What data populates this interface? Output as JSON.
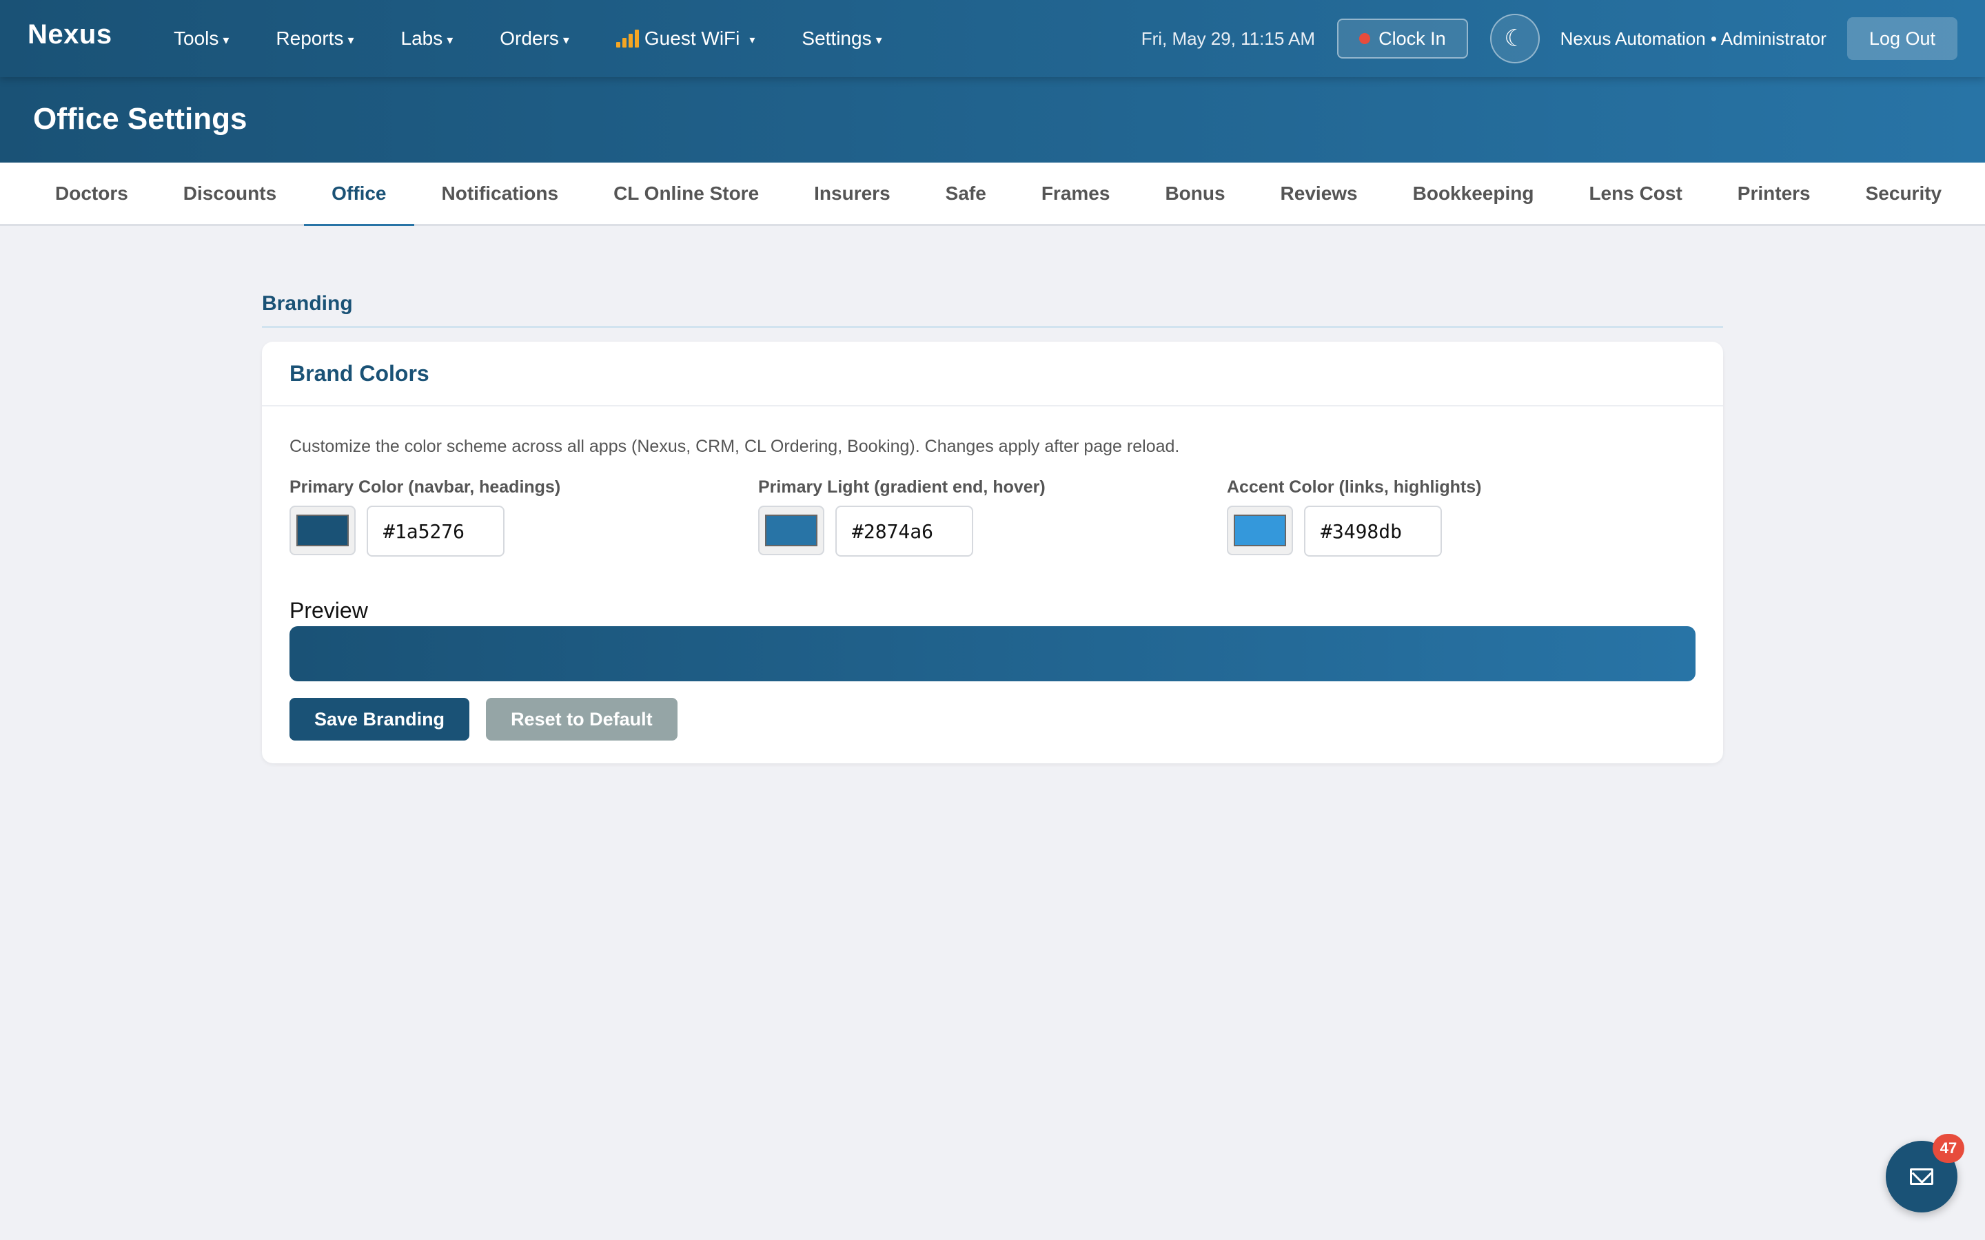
{
  "navbar": {
    "brand": "Nexus",
    "menu": [
      {
        "label": "Tools",
        "caret": "▾"
      },
      {
        "label": "Reports",
        "caret": "▾"
      },
      {
        "label": "Labs",
        "caret": "▾"
      },
      {
        "label": "Orders",
        "caret": "▾"
      },
      {
        "label": "Guest WiFi",
        "caret": "▾",
        "icon": "wifi-signal-icon"
      },
      {
        "label": "Settings",
        "caret": "▾"
      }
    ],
    "datetime": "Fri, May 29, 11:15 AM",
    "clock_in_label": "Clock In",
    "clock_status_color": "#e74c3c",
    "theme_toggle_icon": "☾",
    "user_label": "Nexus Automation • Administrator",
    "logout_label": "Log Out"
  },
  "page_title": "Office Settings",
  "tabs": [
    {
      "label": "Doctors",
      "active": false
    },
    {
      "label": "Discounts",
      "active": false
    },
    {
      "label": "Office",
      "active": true
    },
    {
      "label": "Notifications",
      "active": false
    },
    {
      "label": "CL Online Store",
      "active": false
    },
    {
      "label": "Insurers",
      "active": false
    },
    {
      "label": "Safe",
      "active": false
    },
    {
      "label": "Frames",
      "active": false
    },
    {
      "label": "Bonus",
      "active": false
    },
    {
      "label": "Reviews",
      "active": false
    },
    {
      "label": "Bookkeeping",
      "active": false
    },
    {
      "label": "Lens Cost",
      "active": false
    },
    {
      "label": "Printers",
      "active": false
    },
    {
      "label": "Security",
      "active": false
    }
  ],
  "section": {
    "heading": "Branding"
  },
  "card": {
    "title": "Brand Colors",
    "description": "Customize the color scheme across all apps (Nexus, CRM, CL Ordering, Booking). Changes apply after page reload.",
    "colors": [
      {
        "label": "Primary Color (navbar, headings)",
        "value": "#1a5276"
      },
      {
        "label": "Primary Light (gradient end, hover)",
        "value": "#2874a6"
      },
      {
        "label": "Accent Color (links, highlights)",
        "value": "#3498db"
      }
    ],
    "preview_label": "Preview",
    "save_label": "Save Branding",
    "reset_label": "Reset to Default"
  },
  "fab": {
    "icon": "mail-icon",
    "badge_count": "47"
  },
  "theme_colors": {
    "primary": "#1a5276",
    "primary_light": "#2874a6",
    "accent": "#3498db",
    "reset_button": "#95a5a6",
    "badge": "#e74c3c"
  }
}
